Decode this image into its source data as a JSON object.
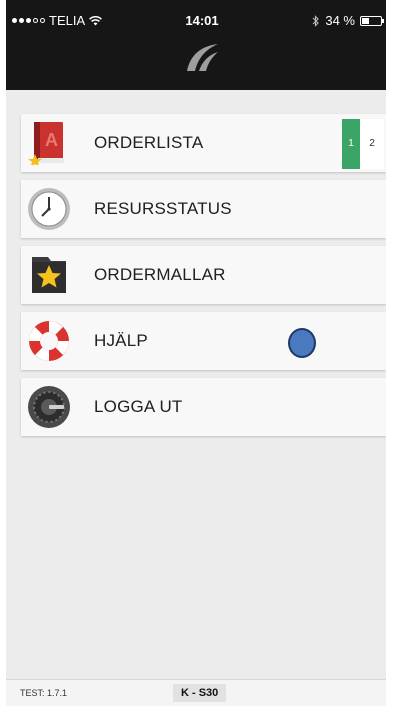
{
  "status_bar": {
    "carrier": "TELIA",
    "time": "14:01",
    "battery": "34 %",
    "battery_level": 0.34
  },
  "menu": {
    "items": [
      {
        "label": "ORDERLISTA",
        "icon": "order-book-icon"
      },
      {
        "label": "RESURSSTATUS",
        "icon": "clock-icon"
      },
      {
        "label": "ORDERMALLAR",
        "icon": "star-folder-icon"
      },
      {
        "label": "HJÄLP",
        "icon": "lifebuoy-icon"
      },
      {
        "label": "LOGGA UT",
        "icon": "lock-dial-icon"
      }
    ],
    "order_badge": [
      "1",
      "2"
    ]
  },
  "footer": {
    "version": "TEST: 1.7.1",
    "station": "K - S30"
  },
  "colors": {
    "header_bg": "#161616",
    "badge_green": "#3aa567",
    "dot_blue": "#4a79bf"
  }
}
